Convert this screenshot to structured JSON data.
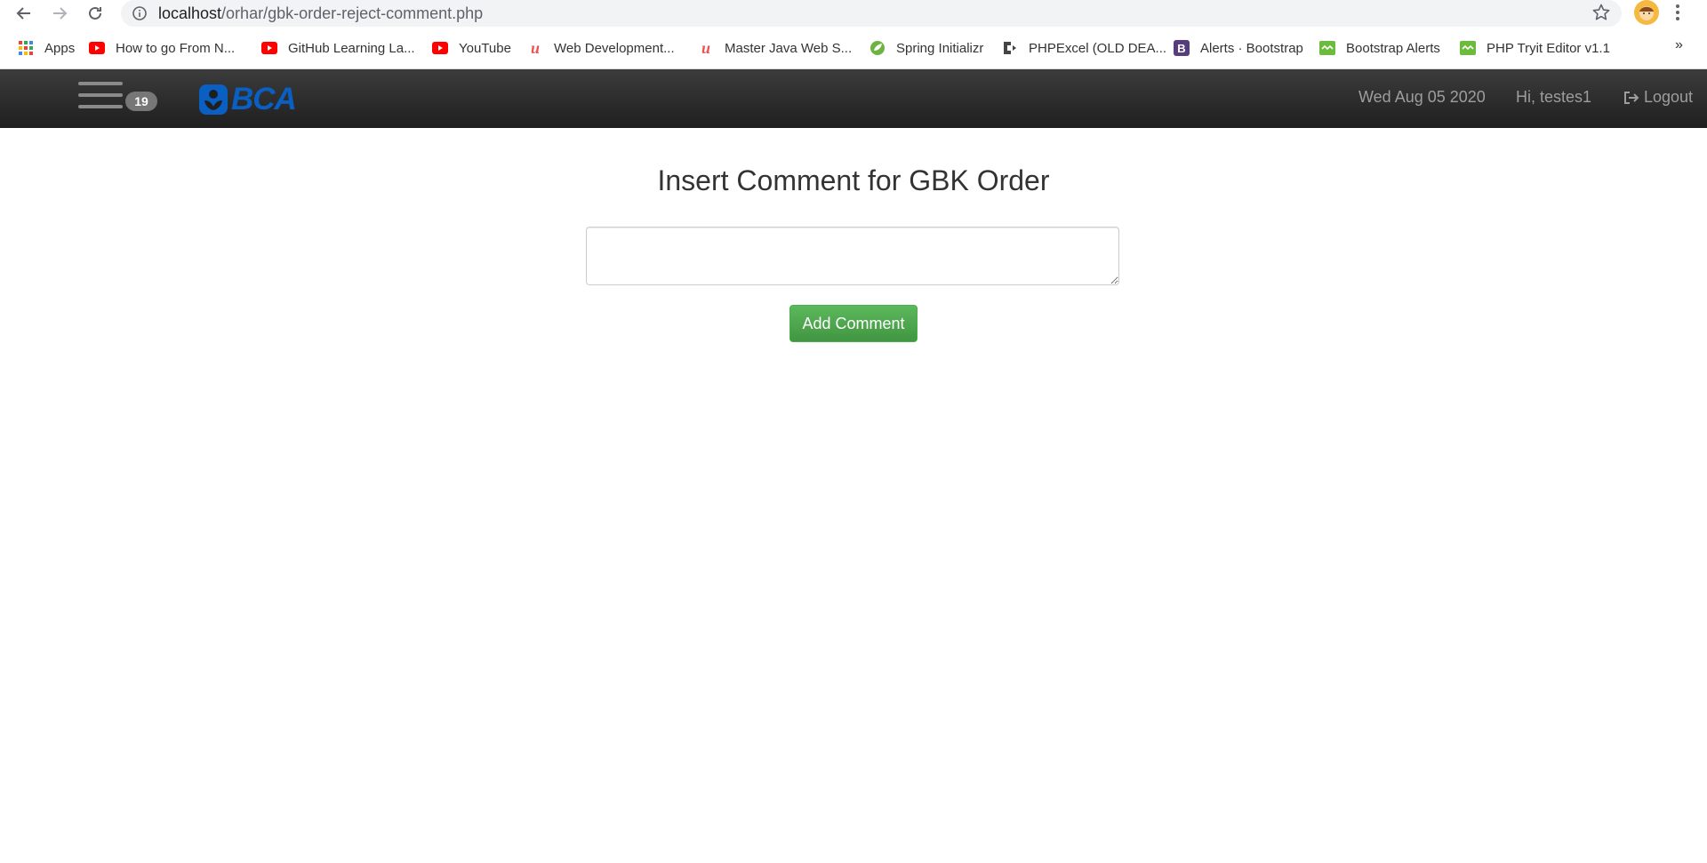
{
  "browser": {
    "url_host": "localhost",
    "url_path": "/orhar/gbk-order-reject-comment.php",
    "bookmarks": [
      {
        "label": "Apps",
        "icon": "apps-grid-icon"
      },
      {
        "label": "How to go From N...",
        "icon": "youtube-icon"
      },
      {
        "label": "GitHub Learning La...",
        "icon": "youtube-icon"
      },
      {
        "label": "YouTube",
        "icon": "youtube-icon"
      },
      {
        "label": "Web Development...",
        "icon": "udemy-icon"
      },
      {
        "label": "Master Java Web S...",
        "icon": "udemy-icon"
      },
      {
        "label": "Spring Initializr",
        "icon": "spring-icon"
      },
      {
        "label": "PHPExcel (OLD DEA...",
        "icon": "codeplex-icon"
      },
      {
        "label": "Alerts · Bootstrap",
        "icon": "bootstrap-icon"
      },
      {
        "label": "Bootstrap Alerts",
        "icon": "bootstrap-alerts-icon"
      },
      {
        "label": "PHP Tryit Editor v1.1",
        "icon": "w3schools-icon"
      }
    ],
    "more_label": "»"
  },
  "navbar": {
    "badge_count": "19",
    "logo_text": "BCA",
    "date": "Wed Aug 05 2020",
    "greeting": "Hi, testes1",
    "logout_label": "Logout"
  },
  "main": {
    "title": "Insert Comment for GBK Order",
    "comment_value": "",
    "add_button_label": "Add Comment"
  },
  "colors": {
    "accent_green": "#5cb85c",
    "logo_blue": "#0a5fc2",
    "navbar_dark": "#222222"
  }
}
